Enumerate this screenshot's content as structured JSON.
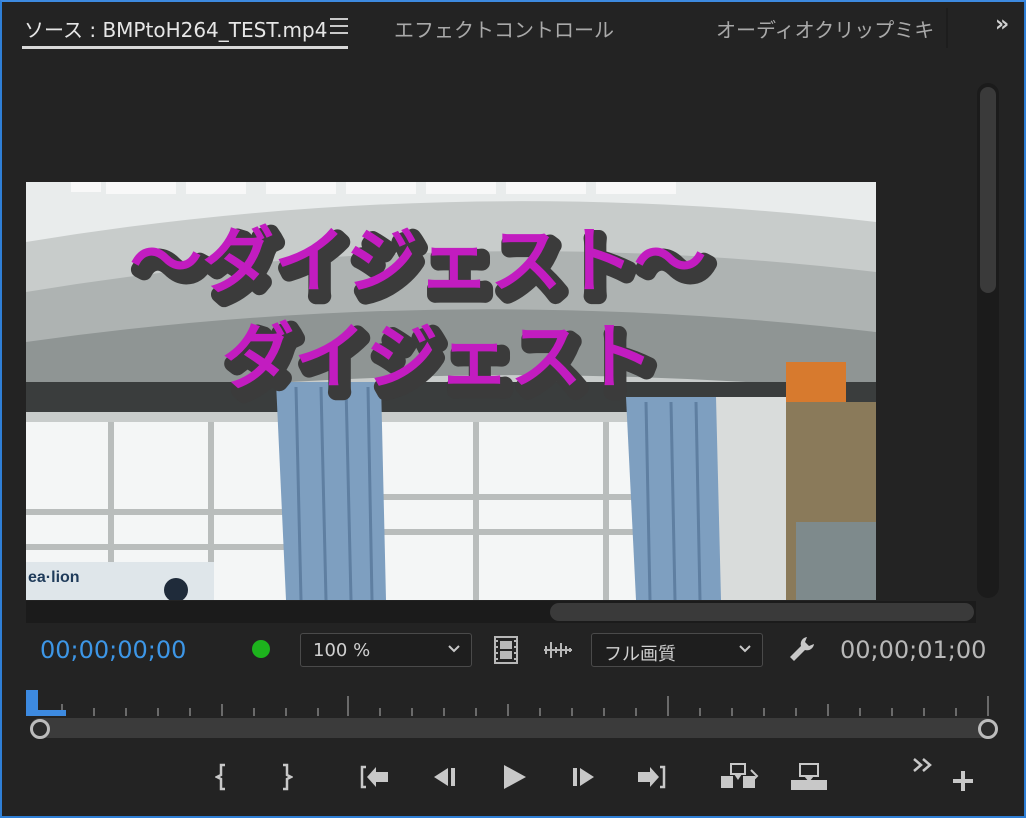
{
  "tabs": [
    {
      "label": "ソース : BMPtoH264_TEST.mp4",
      "active": true
    },
    {
      "label": "エフェクトコントロール",
      "active": false
    },
    {
      "label": "オーディオクリップミキ",
      "active": false
    }
  ],
  "viewer": {
    "title_line1": "〜ダイジェスト〜",
    "title_line2": "ダイジェスト",
    "sign_text": "ea·lion"
  },
  "controls": {
    "timecode_current": "00;00;00;00",
    "timecode_duration": "00;00;01;00",
    "zoom_value": "100 %",
    "quality_value": "フル画質"
  },
  "colors": {
    "accent": "#3d8ae0",
    "timecode_blue": "#3d96e6",
    "status_green": "#1db31d",
    "title_magenta": "#c21cc0"
  }
}
